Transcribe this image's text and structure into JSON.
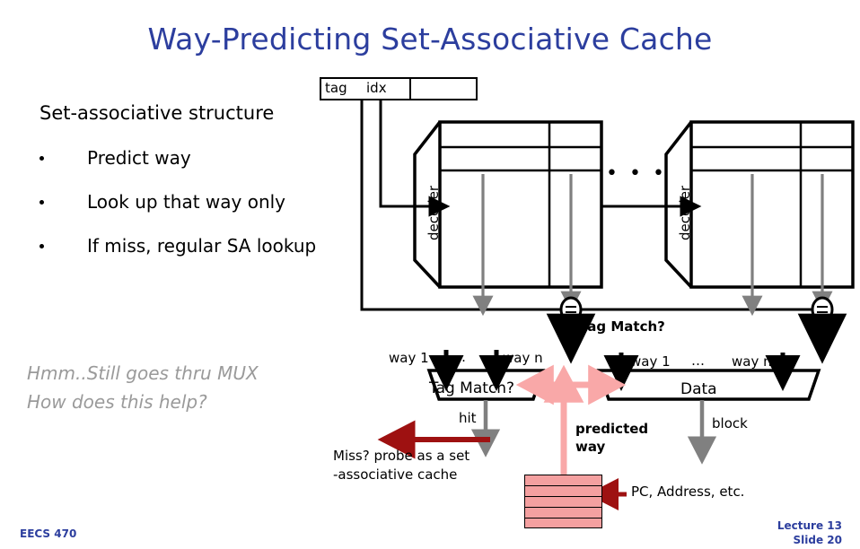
{
  "slide": {
    "title": "Way-Predicting Set-Associative Cache",
    "title_color": "#2c3e9e"
  },
  "content": {
    "lead": "Set-associative structure",
    "bullets": [
      {
        "label": "Predict way"
      },
      {
        "label": "Look up that way only"
      },
      {
        "label": "If miss, regular SA lookup"
      }
    ],
    "comment_line1": "Hmm..Still goes thru MUX",
    "comment_line2": "How does this help?",
    "comment_color": "#9a9a9a"
  },
  "diagram": {
    "address": {
      "tag": "tag",
      "idx": "idx"
    },
    "decoders": [
      {
        "label": "decoder"
      },
      {
        "label": "decoder"
      }
    ],
    "array_ellipsis": "• • •",
    "tag_match_bus_label": "Tag Match?",
    "mux_left": {
      "label": "Tag Match?",
      "input_first": "way 1",
      "input_ellipsis": "…",
      "input_last": "way n",
      "output": "hit"
    },
    "mux_right": {
      "label": "Data",
      "input_first": "way 1",
      "input_ellipsis": "…",
      "input_last": "way n",
      "output": "block"
    },
    "miss_note_line1": "Miss? probe as a set",
    "miss_note_line2": "-associative cache",
    "predicted_way_line1": "predicted",
    "predicted_way_line2": "way",
    "pc_address_label": "PC, Address, etc.",
    "predict_table_color": "#f4a0a0",
    "predict_arrow_color": "#f9a8a8",
    "miss_arrow_color": "#9e1111",
    "wire_color": "#808080"
  },
  "footer": {
    "course": "EECS  470",
    "lecture": "Lecture  13",
    "slide": "Slide  20",
    "color": "#2c3e9e"
  }
}
